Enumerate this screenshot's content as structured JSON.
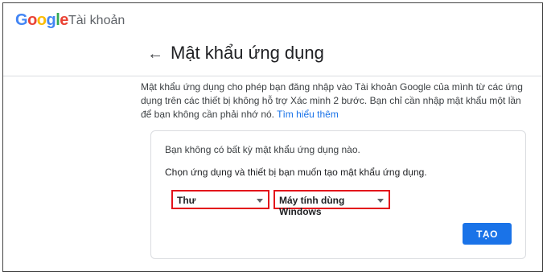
{
  "header": {
    "logo_letters": [
      {
        "char": "G",
        "color": "#4285f4"
      },
      {
        "char": "o",
        "color": "#ea4335"
      },
      {
        "char": "o",
        "color": "#fbbc05"
      },
      {
        "char": "g",
        "color": "#4285f4"
      },
      {
        "char": "l",
        "color": "#34a853"
      },
      {
        "char": "e",
        "color": "#ea4335"
      }
    ],
    "product_name": "Tài khoản"
  },
  "page": {
    "back_icon": "arrow-left-icon",
    "back_glyph": "←",
    "title": "Mật khẩu ứng dụng",
    "description": "Mật khẩu ứng dụng cho phép bạn đăng nhập vào Tài khoản Google của mình từ các ứng dụng trên các thiết bị không hỗ trợ Xác minh 2 bước. Bạn chỉ cần nhập mật khẩu một lần để bạn không cần phải nhớ nó.",
    "learn_more": "Tìm hiểu thêm"
  },
  "card": {
    "no_passwords": "Bạn không có bất kỳ mật khẩu ứng dụng nào.",
    "choose_prompt": "Chọn ứng dụng và thiết bị bạn muốn tạo mật khẩu ứng dụng.",
    "app_select_value": "Thư",
    "device_select_value": "Máy tính dùng Windows",
    "create_button": "TẠO"
  },
  "colors": {
    "accent": "#1a73e8",
    "highlight": "#e3121b"
  }
}
